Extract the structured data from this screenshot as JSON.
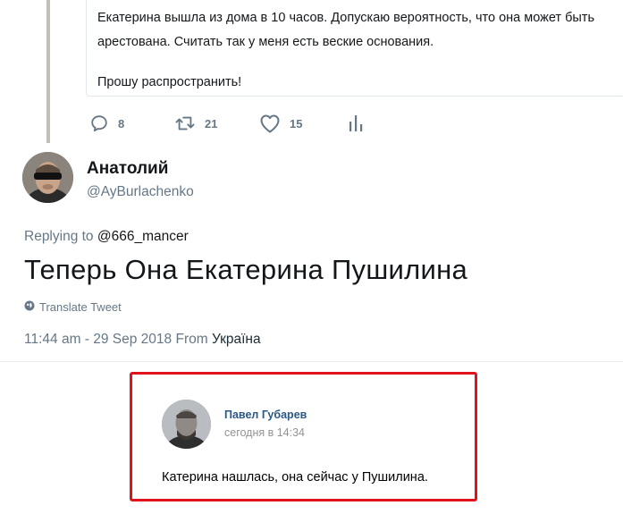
{
  "quoted_tweet": {
    "line1": "Екатерина вышла из дома в 10 часов. Допускаю вероятность, что она может быть",
    "line2": "арестована. Считать так у меня есть веские основания.",
    "line3": "Прошу распространить!"
  },
  "actions": {
    "reply_count": "8",
    "retweet_count": "21",
    "like_count": "15"
  },
  "tweet": {
    "display_name": "Анатолий",
    "handle": "@AyBurlachenko",
    "replying_prefix": "Replying to",
    "replying_to": "@666_mancer",
    "text": "Теперь Она Екатерина Пушилина",
    "translate_label": "Translate Tweet",
    "timestamp": "11:44 am - 29 Sep 2018 From",
    "location": "Україна"
  },
  "vk_post": {
    "author": "Павел Губарев",
    "time": "сегодня в 14:34",
    "text": "Катерина нашлась, она сейчас у Пушилина."
  },
  "colors": {
    "highlight_border": "#e0121b",
    "vk_link": "#2a5885",
    "muted": "#657786"
  }
}
